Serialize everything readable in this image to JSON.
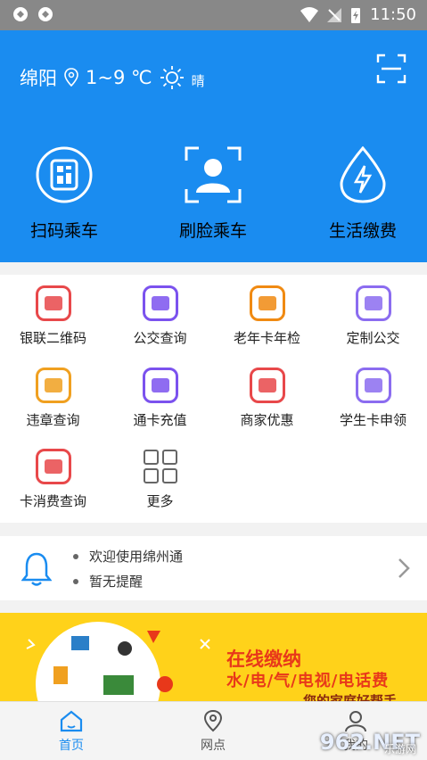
{
  "status": {
    "time": "11:50"
  },
  "header": {
    "city": "绵阳",
    "temp": "1~9 ℃",
    "weather": "晴",
    "icons": {
      "location": "location-pin-icon",
      "sun": "sun-icon",
      "scan": "scan-frame-icon"
    }
  },
  "hero_actions": [
    {
      "label": "扫码乘车",
      "icon": "qr-code-icon"
    },
    {
      "label": "刷脸乘车",
      "icon": "face-scan-icon"
    },
    {
      "label": "生活缴费",
      "icon": "utility-bolt-icon"
    }
  ],
  "services": [
    {
      "label": "银联二维码",
      "icon": "unionpay-card-icon",
      "color": "#e8484a"
    },
    {
      "label": "公交查询",
      "icon": "bus-icon",
      "color": "#7b52ee"
    },
    {
      "label": "老年卡年检",
      "icon": "elder-card-check-icon",
      "color": "#f08a12"
    },
    {
      "label": "定制公交",
      "icon": "diamond-icon",
      "color": "#8b6cf0"
    },
    {
      "label": "违章查询",
      "icon": "traffic-violation-icon",
      "color": "#f0a020"
    },
    {
      "label": "通卡充值",
      "icon": "card-recharge-icon",
      "color": "#7b52ee"
    },
    {
      "label": "商家优惠",
      "icon": "merchant-discount-icon",
      "color": "#e8484a"
    },
    {
      "label": "学生卡申领",
      "icon": "student-card-icon",
      "color": "#8b6cf0"
    },
    {
      "label": "卡消费查询",
      "icon": "card-consumption-icon",
      "color": "#e8484a"
    },
    {
      "label": "更多",
      "icon": "more-grid-icon",
      "color": "#666666"
    }
  ],
  "notice": {
    "lines": [
      "欢迎使用绵州通",
      "暂无提醒"
    ],
    "icon": "bell-icon"
  },
  "banner": {
    "title": "在线缴纳",
    "subtitle": "水/电/气/电视/电话费",
    "tagline": "您的家庭好帮手"
  },
  "tabs": [
    {
      "label": "首页",
      "icon": "home-icon",
      "active": true
    },
    {
      "label": "网点",
      "icon": "location-icon",
      "active": false
    },
    {
      "label": "我的",
      "icon": "profile-icon",
      "active": false
    }
  ],
  "watermark": {
    "text": "962.NET",
    "sub": "乐游网"
  },
  "colors": {
    "primary": "#1a8cf0",
    "banner": "#ffd21a",
    "banner_text": "#e8381a"
  }
}
